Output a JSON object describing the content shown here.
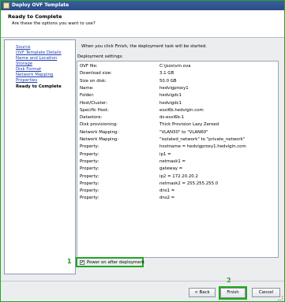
{
  "window": {
    "title": "Deploy OVF Template"
  },
  "header": {
    "title": "Ready to Complete",
    "subtitle": "Are these the options you want to use?"
  },
  "sidebar": {
    "items": [
      {
        "label": "Source",
        "active": false
      },
      {
        "label": "OVF Template Details",
        "active": false
      },
      {
        "label": "Name and Location",
        "active": false
      },
      {
        "label": "Storage",
        "active": false
      },
      {
        "label": "Disk Format",
        "active": false
      },
      {
        "label": "Network Mapping",
        "active": false
      },
      {
        "label": "Properties",
        "active": false
      },
      {
        "label": "Ready to Complete",
        "active": true
      }
    ]
  },
  "main": {
    "intro": "When you click Finish, the deployment task will be started.",
    "settings_label": "Deployment settings:",
    "settings": [
      {
        "key": "OVF file:",
        "value": "C:\\jsos\\vm.ova"
      },
      {
        "key": "Download size:",
        "value": "3.1 GB"
      },
      {
        "key": "Size on disk:",
        "value": "50.0 GB"
      },
      {
        "key": "Name:",
        "value": "hedvigproxy1"
      },
      {
        "key": "Folder:",
        "value": "hedvigdc1"
      },
      {
        "key": "Host/Cluster:",
        "value": "hedvigdc1"
      },
      {
        "key": "Specific Host:",
        "value": "esxi6b.hedvigin.com"
      },
      {
        "key": "Datastore:",
        "value": "ds-esxi6b-1"
      },
      {
        "key": "Disk provisioning:",
        "value": "Thick Provision Lazy Zeroed"
      },
      {
        "key": "Network Mapping:",
        "value": "\"VLAN30\" to \"VLAN60\""
      },
      {
        "key": "Network Mapping:",
        "value": "\"isolated_network\" to \"private_network\""
      },
      {
        "key": "Property:",
        "value": "hostname = hedvigproxy1.hedvigin.com"
      },
      {
        "key": "Property:",
        "value": "ip1 ="
      },
      {
        "key": "Property:",
        "value": "netmask1 ="
      },
      {
        "key": "Property:",
        "value": "gateway ="
      },
      {
        "key": "Property:",
        "value": "ip2 = 172.20.20.2"
      },
      {
        "key": "Property:",
        "value": "netmask2 = 255.255.255.0"
      },
      {
        "key": "Property:",
        "value": "dns1 ="
      },
      {
        "key": "Property:",
        "value": "dns2 ="
      }
    ],
    "power_on_label": "Power on after deployment",
    "power_on_checked": true,
    "power_on_checkmark": "✔"
  },
  "callouts": {
    "one": "1",
    "two": "2"
  },
  "buttons": {
    "back": "< Back",
    "finish": "Finish",
    "cancel": "Cancel"
  },
  "colors": {
    "callout_green": "#1fa81f",
    "title_blue": "#2b4d87",
    "link_blue": "#1f3fb3"
  }
}
